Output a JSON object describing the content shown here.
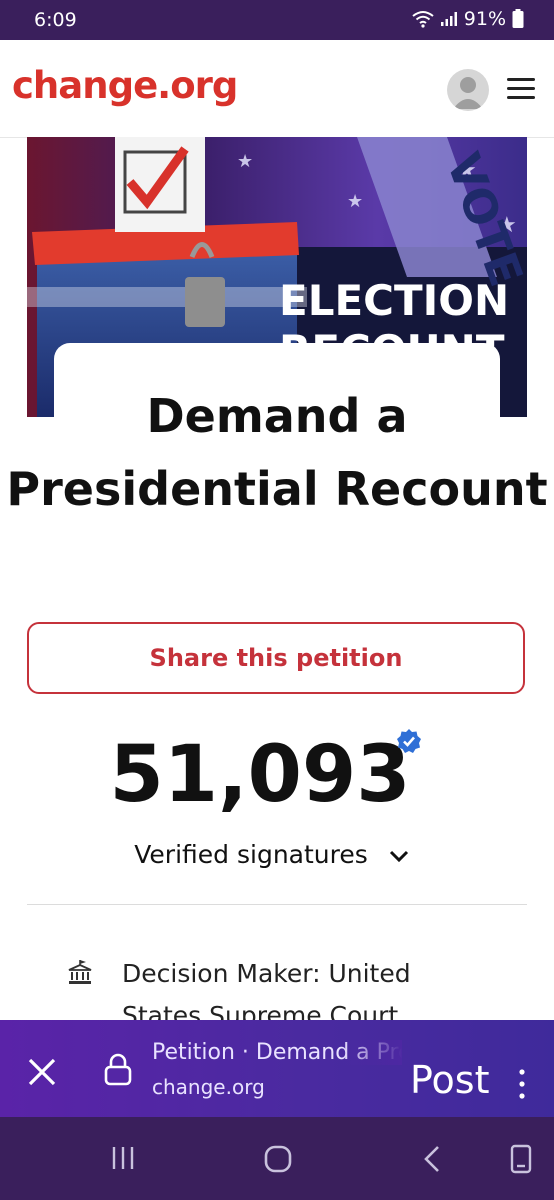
{
  "status_bar": {
    "time": "6:09",
    "battery": "91%"
  },
  "header": {
    "logo": "change.org"
  },
  "hero": {
    "image_text": "ELECTION",
    "image_text2": "RECOUNT",
    "image_text3": "VOTE"
  },
  "petition": {
    "title": "Demand a Presidential Recount",
    "share_label": "Share this petition",
    "signature_count": "51,093",
    "signature_label": "Verified signatures",
    "decision_maker": "Decision Maker: United States Supreme Court"
  },
  "browser_bar": {
    "page_title": "Petition · Demand a Presidential Recount",
    "url": "change.org",
    "post_label": "Post"
  },
  "colors": {
    "brand": "#d8322b",
    "share_border": "#c5323b",
    "badge": "#2f6fd6",
    "bar": "#3a1f5c"
  }
}
